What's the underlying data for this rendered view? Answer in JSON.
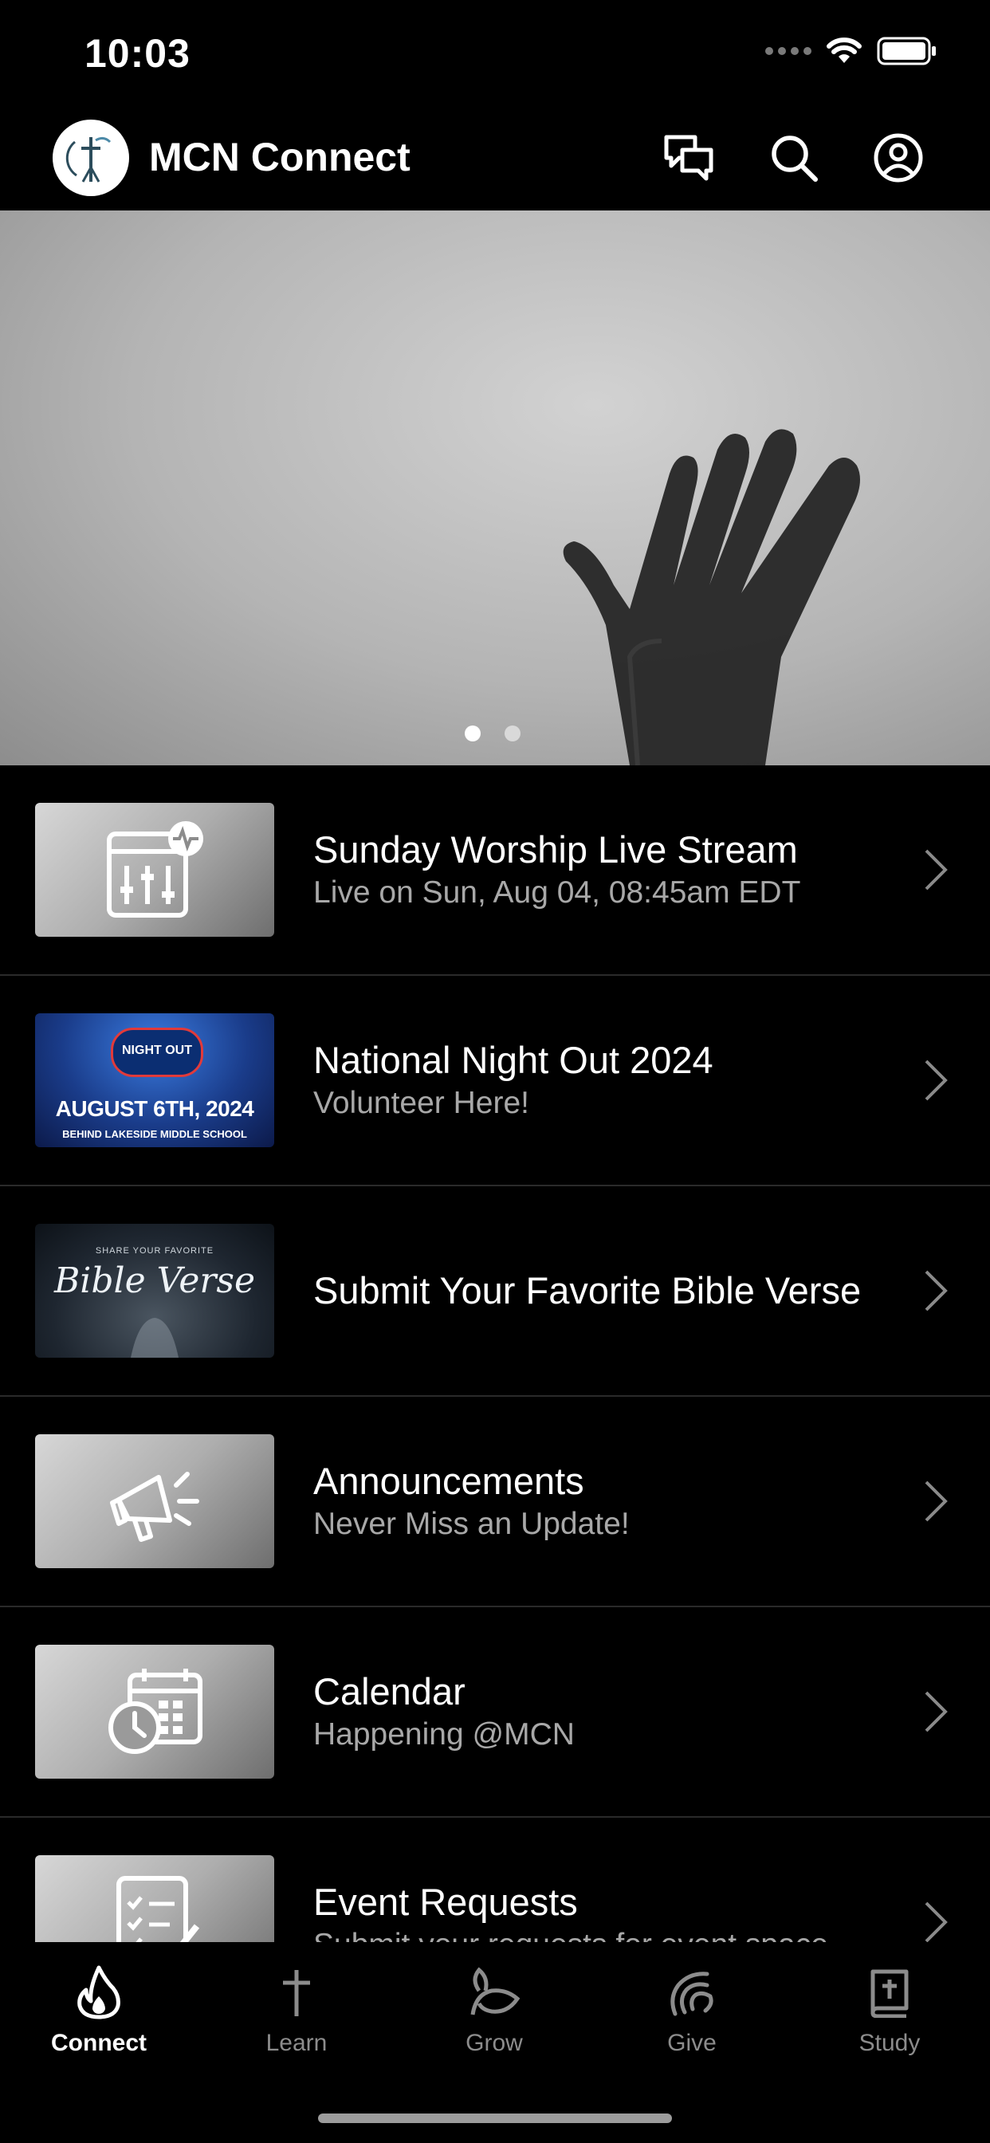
{
  "status_bar": {
    "time": "10:03"
  },
  "header": {
    "title": "MCN Connect"
  },
  "hero": {
    "pages": 2,
    "active_page": 1
  },
  "list": [
    {
      "title": "Sunday Worship Live Stream",
      "subtitle": "Live on Sun, Aug 04, 08:45am EDT",
      "thumb_icon": "mixer-sliders-icon"
    },
    {
      "title": "National Night Out 2024",
      "subtitle": "Volunteer Here!",
      "thumb_icon": "night-out-banner",
      "banner": {
        "badge": "NIGHT OUT",
        "date": "AUGUST 6TH, 2024",
        "location": "BEHIND LAKESIDE MIDDLE SCHOOL"
      }
    },
    {
      "title": "Submit Your Favorite Bible Verse",
      "subtitle": "",
      "thumb_icon": "bible-verse-banner",
      "banner": {
        "kicker": "SHARE YOUR FAVORITE",
        "script": "Bible Verse"
      }
    },
    {
      "title": "Announcements",
      "subtitle": "Never Miss an Update!",
      "thumb_icon": "megaphone-icon"
    },
    {
      "title": "Calendar",
      "subtitle": "Happening @MCN",
      "thumb_icon": "calendar-clock-icon"
    },
    {
      "title": "Event Requests",
      "subtitle": "Submit your requests for event space",
      "thumb_icon": "checklist-icon"
    }
  ],
  "tabs": [
    {
      "label": "Connect",
      "icon": "flame-icon",
      "active": true
    },
    {
      "label": "Learn",
      "icon": "cross-icon",
      "active": false
    },
    {
      "label": "Grow",
      "icon": "leaf-icon",
      "active": false
    },
    {
      "label": "Give",
      "icon": "give-icon",
      "active": false
    },
    {
      "label": "Study",
      "icon": "bible-icon",
      "active": false
    }
  ],
  "colors": {
    "background": "#000000",
    "text": "#ffffff",
    "subtext": "#a8a8a8",
    "divider": "#2a2a2a",
    "tab_inactive": "#8c8c8c"
  }
}
